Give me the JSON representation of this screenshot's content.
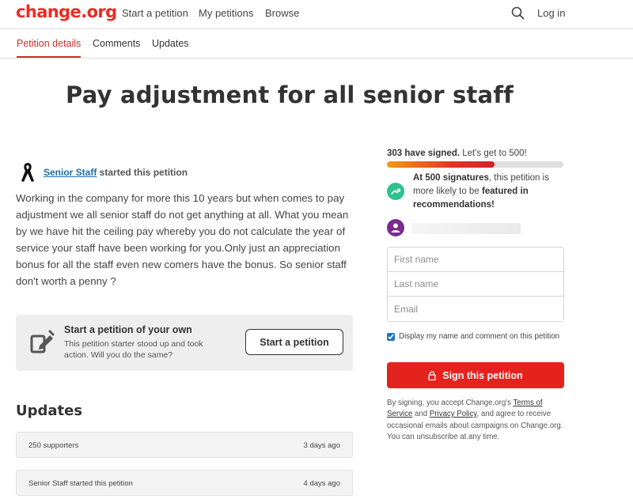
{
  "brand": {
    "logo": "change.org",
    "accent": "#ec2c22"
  },
  "nav": {
    "start": "Start a petition",
    "my": "My petitions",
    "browse": "Browse",
    "login": "Log in",
    "search_icon": "search-icon"
  },
  "tabs": {
    "details": "Petition details",
    "comments": "Comments",
    "updates": "Updates"
  },
  "petition": {
    "title": "Pay adjustment for all senior staff",
    "starter_name": "Senior Staff",
    "starter_suffix": " started this petition",
    "description": "Working in the company for more this 10 years but when comes to pay adjustment we all senior staff do not get anything at all. What you mean by we have hit the ceiling pay whereby you do not calculate the year of service your staff have been working for you.Only just an appreciation bonus for all the staff even new comers have the bonus. So senior staff don't worth a penny ?"
  },
  "promo": {
    "title": "Start a petition of your own",
    "subtitle": "This petition starter stood up and took action. Will you do the same?",
    "button": "Start a petition"
  },
  "updates": {
    "heading": "Updates",
    "items": [
      {
        "text": "250 supporters",
        "date": "3 days ago"
      },
      {
        "text": "Senior Staff started this petition",
        "date": "4 days ago"
      }
    ]
  },
  "sign": {
    "signed_count": "303 have signed.",
    "signed_goal": " Let's get to 500!",
    "progress_fraction": 0.61,
    "milestone_bold1": "At 500 signatures",
    "milestone_mid": ", this petition is more likely to be ",
    "milestone_bold2": "featured in recommendations!",
    "first_name_placeholder": "First name",
    "last_name_placeholder": "Last name",
    "email_placeholder": "Email",
    "consent_label": "Display my name and comment on this petition",
    "consent_checked": true,
    "button": "Sign this petition",
    "legal_pre": "By signing, you accept Change.org's ",
    "terms": "Terms of Service",
    "legal_and": " and ",
    "privacy": "Privacy Policy",
    "legal_post": ", and agree to receive occasional emails about campaigns on Change.org. You can unsubscribe at any time."
  }
}
